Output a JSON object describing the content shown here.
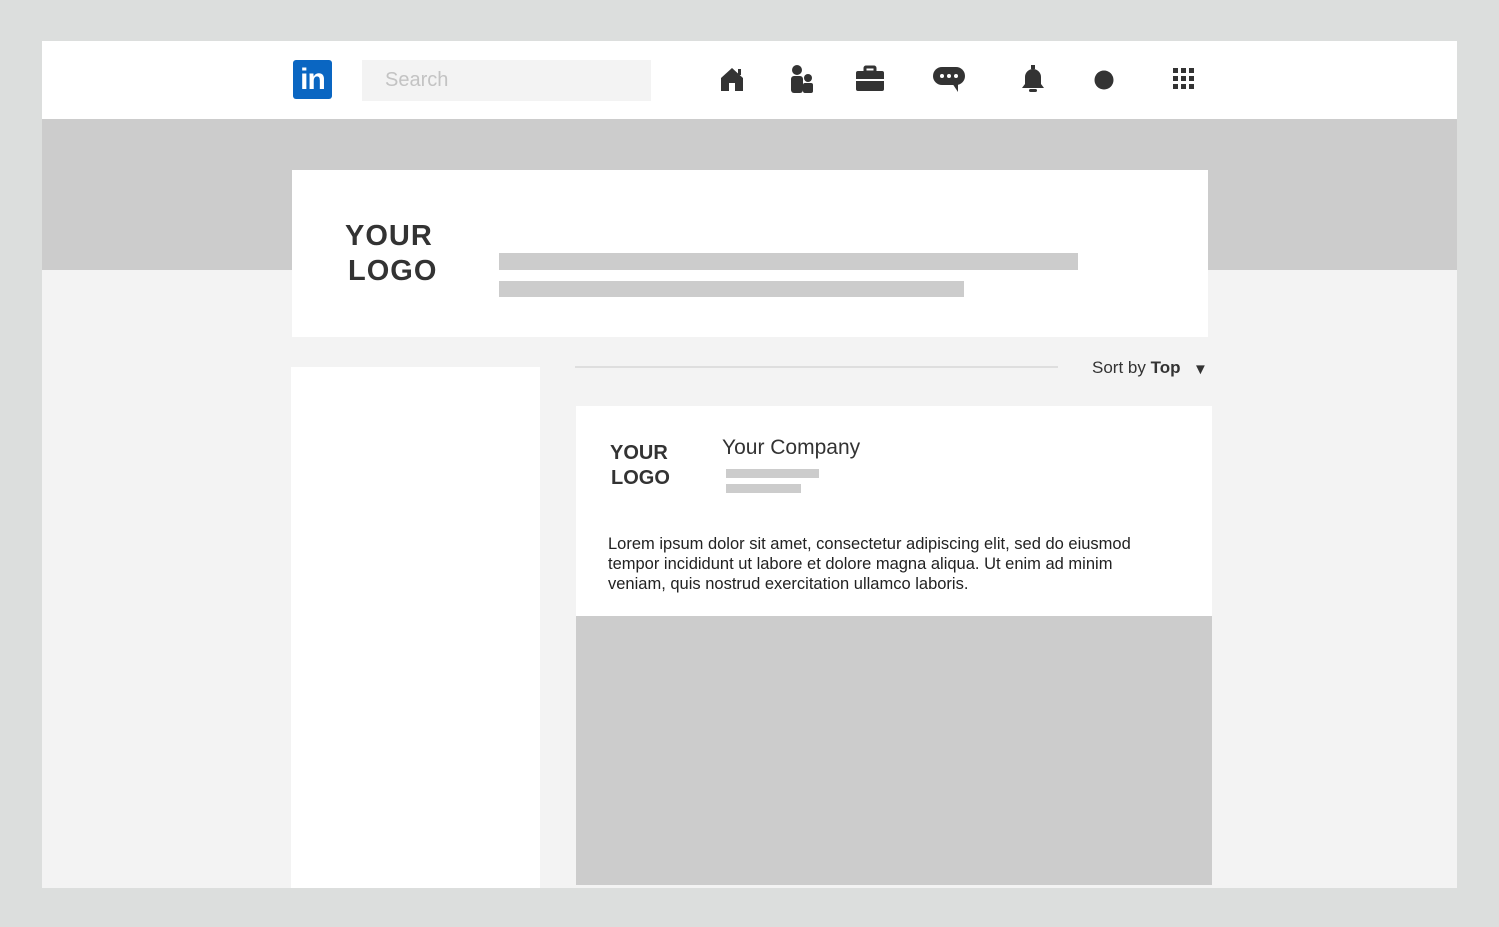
{
  "topbar": {
    "brand_text": "in",
    "search": {
      "placeholder": "Search"
    },
    "nav_icons": [
      "home-icon",
      "my-network-icon",
      "jobs-icon",
      "messaging-icon",
      "notifications-icon",
      "profile-icon",
      "apps-grid-icon"
    ]
  },
  "colors": {
    "brand": "#0a66c2",
    "placeholder_bar": "#cccccc",
    "page_bg": "#f3f3f3",
    "outer_bg": "#dcdedd"
  },
  "header": {
    "logo_line1": "YOUR",
    "logo_line2": "LOGO"
  },
  "feed": {
    "sort_prefix": "Sort by",
    "sort_value": "Top",
    "sort_caret": "▼"
  },
  "post": {
    "logo_line1": "YOUR",
    "logo_line2": "LOGO",
    "company": "Your Company",
    "text": "Lorem ipsum dolor sit amet, consectetur adipiscing elit, sed do eiusmod tempor incididunt ut labore et dolore magna aliqua. Ut enim ad minim veniam, quis nostrud exercitation ullamco laboris."
  }
}
